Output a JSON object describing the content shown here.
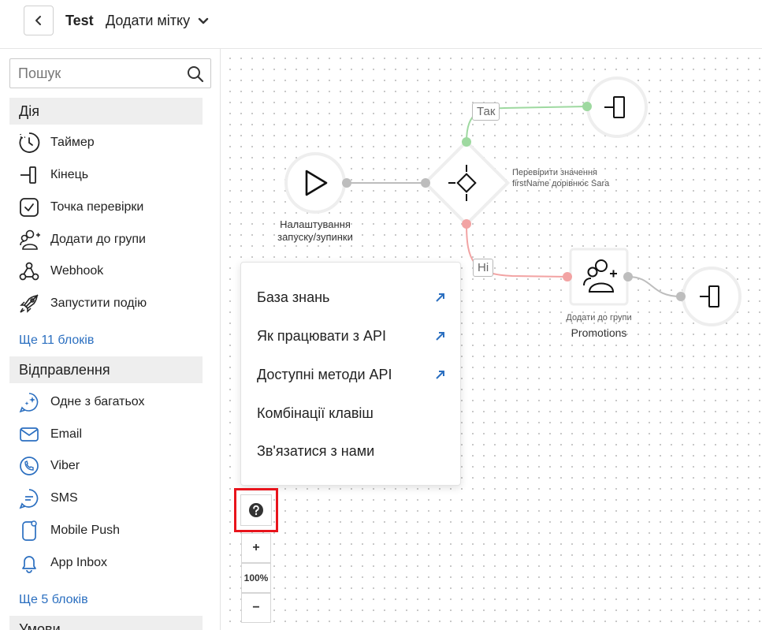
{
  "header": {
    "title": "Test",
    "add_label": "Додати мітку"
  },
  "sidebar": {
    "search_placeholder": "Пошук",
    "sections": [
      {
        "title": "Дія",
        "items": [
          {
            "label": "Таймер",
            "icon": "timer-icon"
          },
          {
            "label": "Кінець",
            "icon": "end-icon"
          },
          {
            "label": "Точка перевірки",
            "icon": "checkpoint-icon"
          },
          {
            "label": "Додати до групи",
            "icon": "add-group-icon"
          },
          {
            "label": "Webhook",
            "icon": "webhook-icon"
          },
          {
            "label": "Запустити подію",
            "icon": "rocket-icon"
          }
        ],
        "more": "Ще 11 блоків"
      },
      {
        "title": "Відправлення",
        "items": [
          {
            "label": "Одне з багатьох",
            "icon": "sparkle-chat-icon"
          },
          {
            "label": "Email",
            "icon": "email-icon"
          },
          {
            "label": "Viber",
            "icon": "viber-icon"
          },
          {
            "label": "SMS",
            "icon": "sms-icon"
          },
          {
            "label": "Mobile Push",
            "icon": "mobile-push-icon"
          },
          {
            "label": "App Inbox",
            "icon": "bell-icon"
          }
        ],
        "more": "Ще 5 блоків"
      },
      {
        "title": "Умови",
        "items": []
      }
    ]
  },
  "canvas": {
    "start_node_label": "Налаштування запуску/зупинки",
    "condition_text": "Перевірити значення firstName дорівнює Sara",
    "branch_yes": "Так",
    "branch_no": "Ні",
    "group_node_caption": "Додати до групи",
    "group_node_name": "Promotions",
    "colors": {
      "yes": "#9ed9a0",
      "no": "#f2a3a3",
      "link": "#bdbdbd"
    }
  },
  "help_menu": {
    "items": [
      {
        "label": "База знань",
        "external": true
      },
      {
        "label": "Як працювати з API",
        "external": true
      },
      {
        "label": "Доступні методи API",
        "external": true
      },
      {
        "label": "Комбінації клавіш",
        "external": false
      },
      {
        "label": "Зв'язатися з нами",
        "external": false
      }
    ]
  },
  "zoom": {
    "plus": "+",
    "level": "100%",
    "minus": "−"
  }
}
